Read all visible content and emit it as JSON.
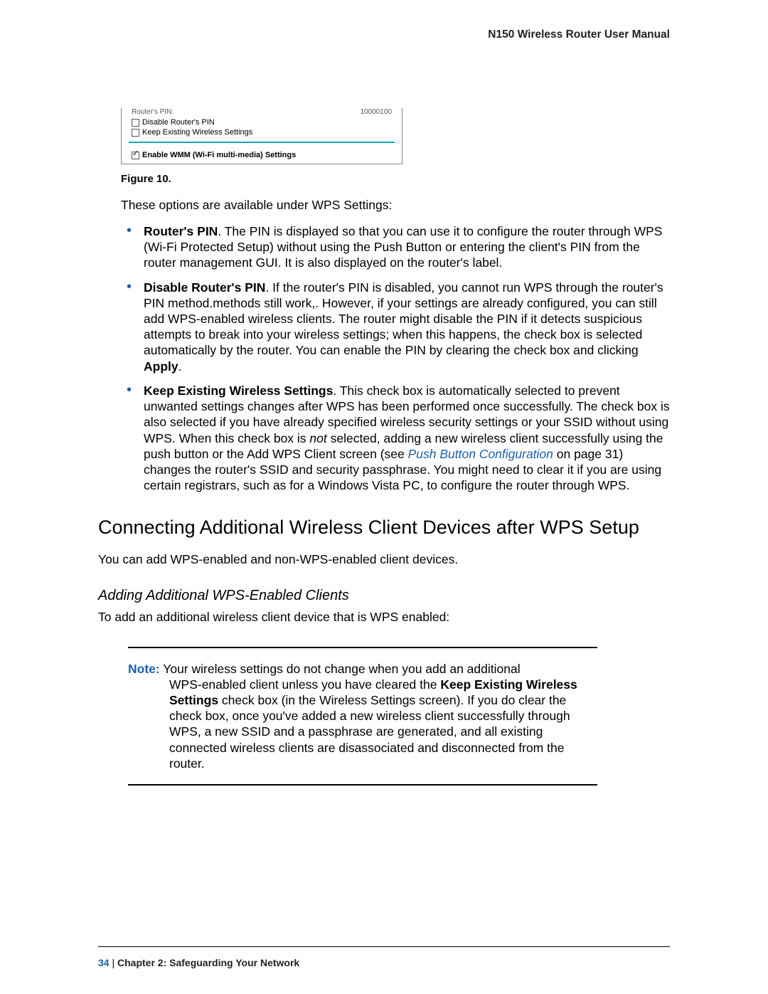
{
  "header": {
    "title": "N150 Wireless Router User Manual"
  },
  "figure": {
    "top_left": "Router's PIN:",
    "top_right": "10000100",
    "opt1": "Disable Router's PIN",
    "opt2": "Keep Existing Wireless Settings",
    "opt3": "Enable WMM (Wi-Fi multi-media) Settings",
    "caption": "Figure 10."
  },
  "intro": "These options are available under WPS Settings:",
  "bullets": [
    {
      "lead": "Router's PIN",
      "text": ". The PIN is displayed so that you can use it to configure the router through WPS (Wi-Fi Protected Setup) without using the Push Button or entering the client's PIN from the router management GUI. It is also displayed on the router's label."
    },
    {
      "lead": "Disable Router's PIN",
      "text_a": ". If the router's PIN is disabled, you cannot run WPS through the router's PIN method.methods still work,. However, if your settings are already configured, you can still add WPS-enabled wireless clients. The router might disable the PIN if it detects suspicious attempts to break into your wireless settings; when this happens, the check box is selected automatically by the router. You can enable the PIN by clearing the check box and clicking ",
      "apply": "Apply",
      "text_b": "."
    },
    {
      "lead": "Keep Existing Wireless Settings",
      "text_a": ". This check box is automatically selected to prevent unwanted settings changes after WPS has been performed once successfully. The check box is also selected if you have already specified wireless security settings or your SSID without using WPS. When this check box is ",
      "not": "not",
      "text_b": " selected, adding a new wireless client successfully using the push button or the Add WPS Client screen (see ",
      "link": "Push Button Configuration",
      "text_c": " on page 31) changes the router's SSID and security passphrase. You might need to clear it if you are using certain registrars, such as for a Windows Vista PC, to configure the router through WPS."
    }
  ],
  "section": "Connecting Additional Wireless Client Devices after WPS Setup",
  "section_intro": "You can add WPS-enabled and non-WPS-enabled client devices.",
  "subsection": "Adding Additional WPS-Enabled Clients",
  "subsection_intro": "To add an additional wireless client device that is WPS enabled:",
  "note": {
    "label": "Note:",
    "line1": "  Your wireless settings do not change when you add an additional",
    "rest_a": "WPS-enabled client unless you have cleared the ",
    "bold": "Keep Existing Wireless Settings",
    "rest_b": " check box (in the Wireless Settings screen). If you do clear the check box, once you've added a new wireless client successfully through WPS, a new SSID and a passphrase are generated, and all existing connected wireless clients are disassociated and disconnected from the router."
  },
  "footer": {
    "page": "34",
    "sep": "   |   ",
    "chapter": "Chapter 2:  Safeguarding Your Network"
  }
}
